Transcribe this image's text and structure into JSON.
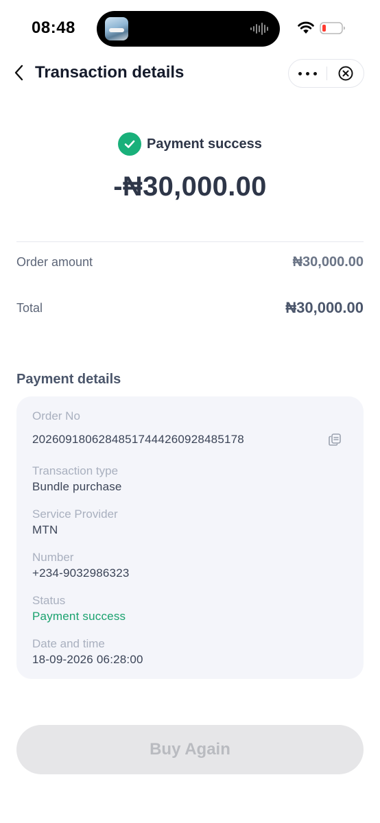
{
  "status_bar": {
    "time": "08:48"
  },
  "header": {
    "title": "Transaction details"
  },
  "summary": {
    "status": "Payment success",
    "amount": "-₦30,000.00"
  },
  "breakdown": {
    "order_amount_label": "Order amount",
    "order_amount_value": "₦30,000.00",
    "total_label": "Total",
    "total_value": "₦30,000.00"
  },
  "payment_details": {
    "title": "Payment details",
    "order_no_label": "Order No",
    "order_no_value": "20260918062848517444260928485178",
    "transaction_type_label": "Transaction type",
    "transaction_type_value": "Bundle purchase",
    "service_provider_label": "Service Provider",
    "service_provider_value": "MTN",
    "number_label": "Number",
    "number_value": "+234-9032986323",
    "status_label": "Status",
    "status_value": "Payment success",
    "datetime_label": "Date and time",
    "datetime_value": "18-09-2026 06:28:00"
  },
  "actions": {
    "buy_again_label": "Buy Again"
  },
  "colors": {
    "success": "#19b07a",
    "title_text": "#151b2b",
    "card_bg": "#f4f5fa",
    "button_disabled_bg": "#e6e6e8"
  },
  "icons": {
    "back": "chevron-left-icon",
    "more": "more-dots-icon",
    "close": "close-circle-icon",
    "success": "check-circle-icon",
    "copy": "copy-icon"
  }
}
